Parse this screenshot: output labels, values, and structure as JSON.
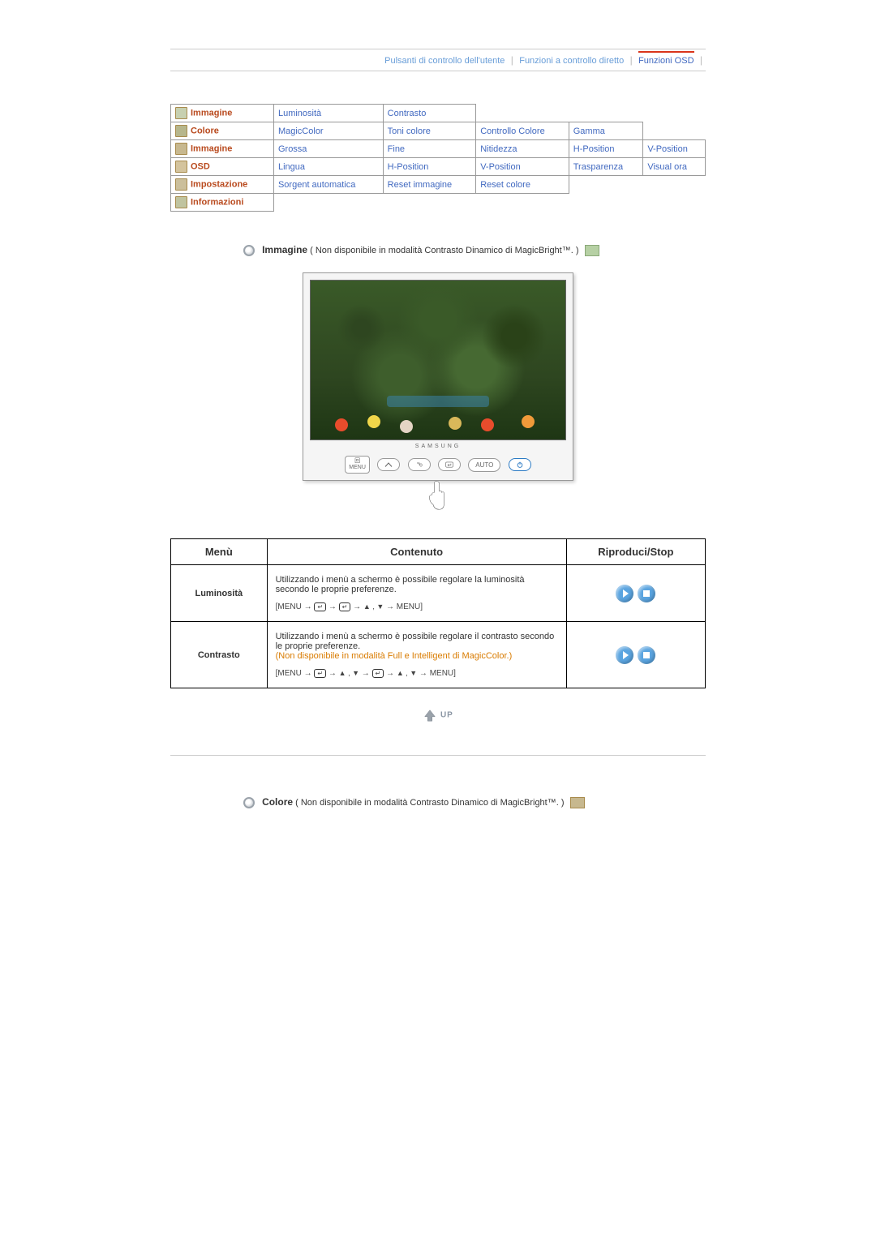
{
  "nav": {
    "l1": "Pulsanti di controllo dell'utente",
    "l2": "Funzioni a controllo diretto",
    "l3": "Funzioni OSD"
  },
  "grid": {
    "r1": {
      "cat": "Immagine",
      "a": "Luminosità",
      "b": "Contrasto"
    },
    "r2": {
      "cat": "Colore",
      "a": "MagicColor",
      "b": "Toni colore",
      "c": "Controllo Colore",
      "d": "Gamma"
    },
    "r3": {
      "cat": "Immagine",
      "a": "Grossa",
      "b": "Fine",
      "c": "Nitidezza",
      "d": "H-Position",
      "e": "V-Position"
    },
    "r4": {
      "cat": "OSD",
      "a": "Lingua",
      "b": "H-Position",
      "c": "V-Position",
      "d": "Trasparenza",
      "e": "Visual ora"
    },
    "r5": {
      "cat": "Impostazione",
      "a": "Sorgent automatica",
      "b": "Reset immagine",
      "c": "Reset colore"
    },
    "r6": {
      "cat": "Informazioni"
    }
  },
  "sec1": {
    "title": "Immagine",
    "note": "( Non disponibile in modalità Contrasto Dinamico di MagicBright™. )"
  },
  "brand": "SAMSUNG",
  "ctrl_auto": "AUTO",
  "ctrl_menu_top": "回",
  "ctrl_menu_bot": "MENU",
  "detail": {
    "h1": "Menù",
    "h2": "Contenuto",
    "h3": "Riproduci/Stop",
    "row1": {
      "m": "Luminosità",
      "c1": "Utilizzando i menù a schermo è possibile regolare la luminosità secondo le proprie preferenze.",
      "seq_a": "[MENU → ",
      "seq_b": " → ",
      "seq_c": " → ",
      "seq_d": " → MENU]"
    },
    "row2": {
      "m": "Contrasto",
      "c1": "Utilizzando i menù a schermo è possibile regolare il contrasto secondo le proprie preferenze.",
      "c2": "(Non disponibile in modalità Full e Intelligent di MagicColor.)",
      "seq_a": "[MENU → ",
      "seq_b": " → ",
      "seq_c": " → ",
      "seq_d": " → ",
      "seq_e": " → MENU]"
    }
  },
  "up": "UP",
  "sec2": {
    "title": "Colore",
    "note": " ( Non disponibile in modalità Contrasto Dinamico di MagicBright™. )"
  },
  "arrows": "▲ , ▼"
}
